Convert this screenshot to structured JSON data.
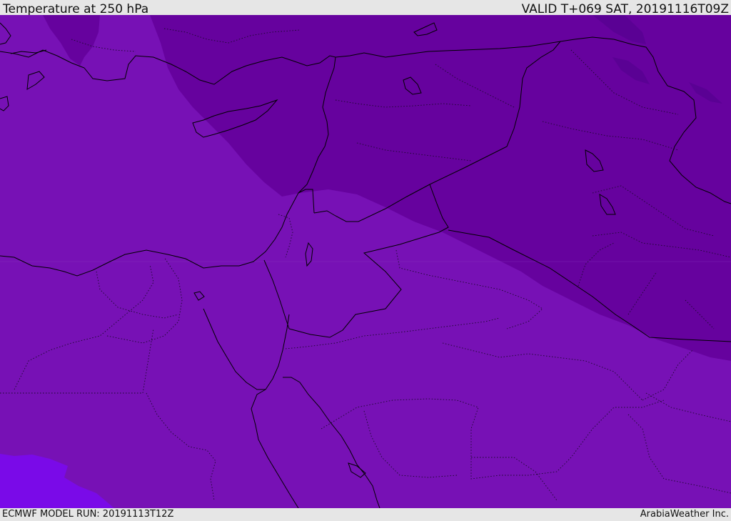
{
  "header": {
    "title": "Temperature at 250 hPa",
    "valid_time": "VALID T+069 SAT, 20191116T09Z"
  },
  "footer": {
    "model_run": "ECMWF MODEL RUN: 20191113T12Z",
    "credit": "ArabiaWeather Inc."
  },
  "colors": {
    "band_main": "#7711b5",
    "band_cold": "#66029e",
    "band_colder": "#5a0194",
    "band_warm_sw": "#7a0ae8",
    "coastline": "#000000",
    "borders": "#1a0a2a"
  },
  "icons": {
    "map": "weather-map"
  }
}
